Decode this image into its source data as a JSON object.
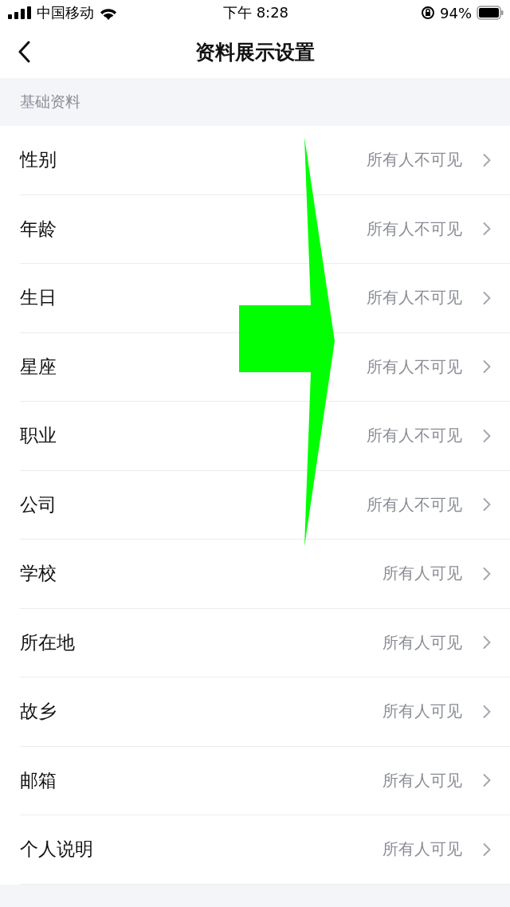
{
  "status_bar": {
    "carrier": "中国移动",
    "time": "下午 8:28",
    "battery": "94%"
  },
  "nav": {
    "title": "资料展示设置"
  },
  "sections": [
    {
      "title": "基础资料",
      "rows": [
        {
          "label": "性别",
          "value": "所有人不可见"
        },
        {
          "label": "年龄",
          "value": "所有人不可见"
        },
        {
          "label": "生日",
          "value": "所有人不可见"
        },
        {
          "label": "星座",
          "value": "所有人不可见"
        },
        {
          "label": "职业",
          "value": "所有人不可见"
        },
        {
          "label": "公司",
          "value": "所有人不可见"
        },
        {
          "label": "学校",
          "value": "所有人可见"
        },
        {
          "label": "所在地",
          "value": "所有人可见"
        },
        {
          "label": "故乡",
          "value": "所有人可见"
        },
        {
          "label": "邮箱",
          "value": "所有人可见"
        },
        {
          "label": "个人说明",
          "value": "所有人可见"
        }
      ]
    }
  ]
}
